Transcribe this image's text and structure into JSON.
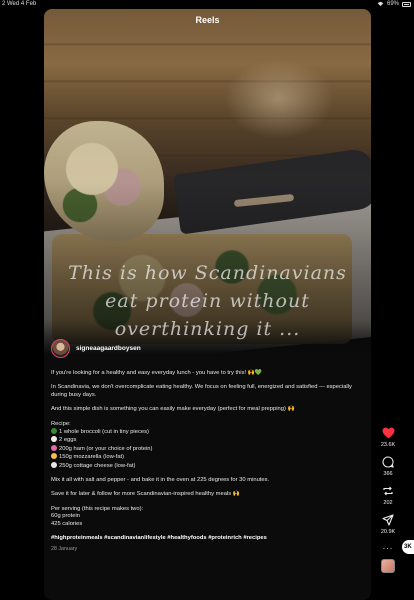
{
  "status_bar": {
    "time": "2  Wed 4 Feb",
    "battery": "69%"
  },
  "header": {
    "title": "Reels"
  },
  "overlay_text": {
    "line1": "This is how Scandinavians",
    "line2": "eat protein without",
    "line3": "overthinking it ..."
  },
  "post": {
    "username": "signeaagaardboysen",
    "intro": "If you're looking for a healthy and easy everyday lunch - you have to try this! 🙌💚",
    "para2": "In Scandinavia, we don't overcomplicate eating healthy. We focus on feeling full, energized and satisfied — especially during busy days.",
    "para3": "And this simple dish is something you can easily make everyday (perfect for meal prepping) 🙌",
    "recipe_title": "Recipe:",
    "ingredients": [
      "1 whole broccoli (cut in tiny pieces)",
      "2 eggs",
      "200g ham (or your choice of protein)",
      "150g mozzarella (low-fat)",
      "250g cottage cheese (low-fat)"
    ],
    "ingredient_emoji_colors": [
      "#3c8a2e",
      "#f0eee6",
      "#e16aa0",
      "#f2c04a",
      "#e8e8e8"
    ],
    "method": "Mix it all with salt and pepper - and bake it in the oven at 225 degrees for 30 minutes.",
    "save_note": "Save it for later & follow for more Scandinavian-inspired healthy meals 🙌",
    "serving_title": "Per serving (this recipe makes two):",
    "serving_protein": "60g protein",
    "serving_calories": "425 calories",
    "hashtags": "#highproteinmeals #scandinavianlifestyle #healthyfoods #proteinrich #recipes",
    "date": "28 January"
  },
  "actions": {
    "likes": "23.6K",
    "comments": "366",
    "reposts": "202",
    "shares": "20.9K",
    "more": "...",
    "like_color": "#ff3040"
  },
  "edge_badge": {
    "label": "3K"
  }
}
